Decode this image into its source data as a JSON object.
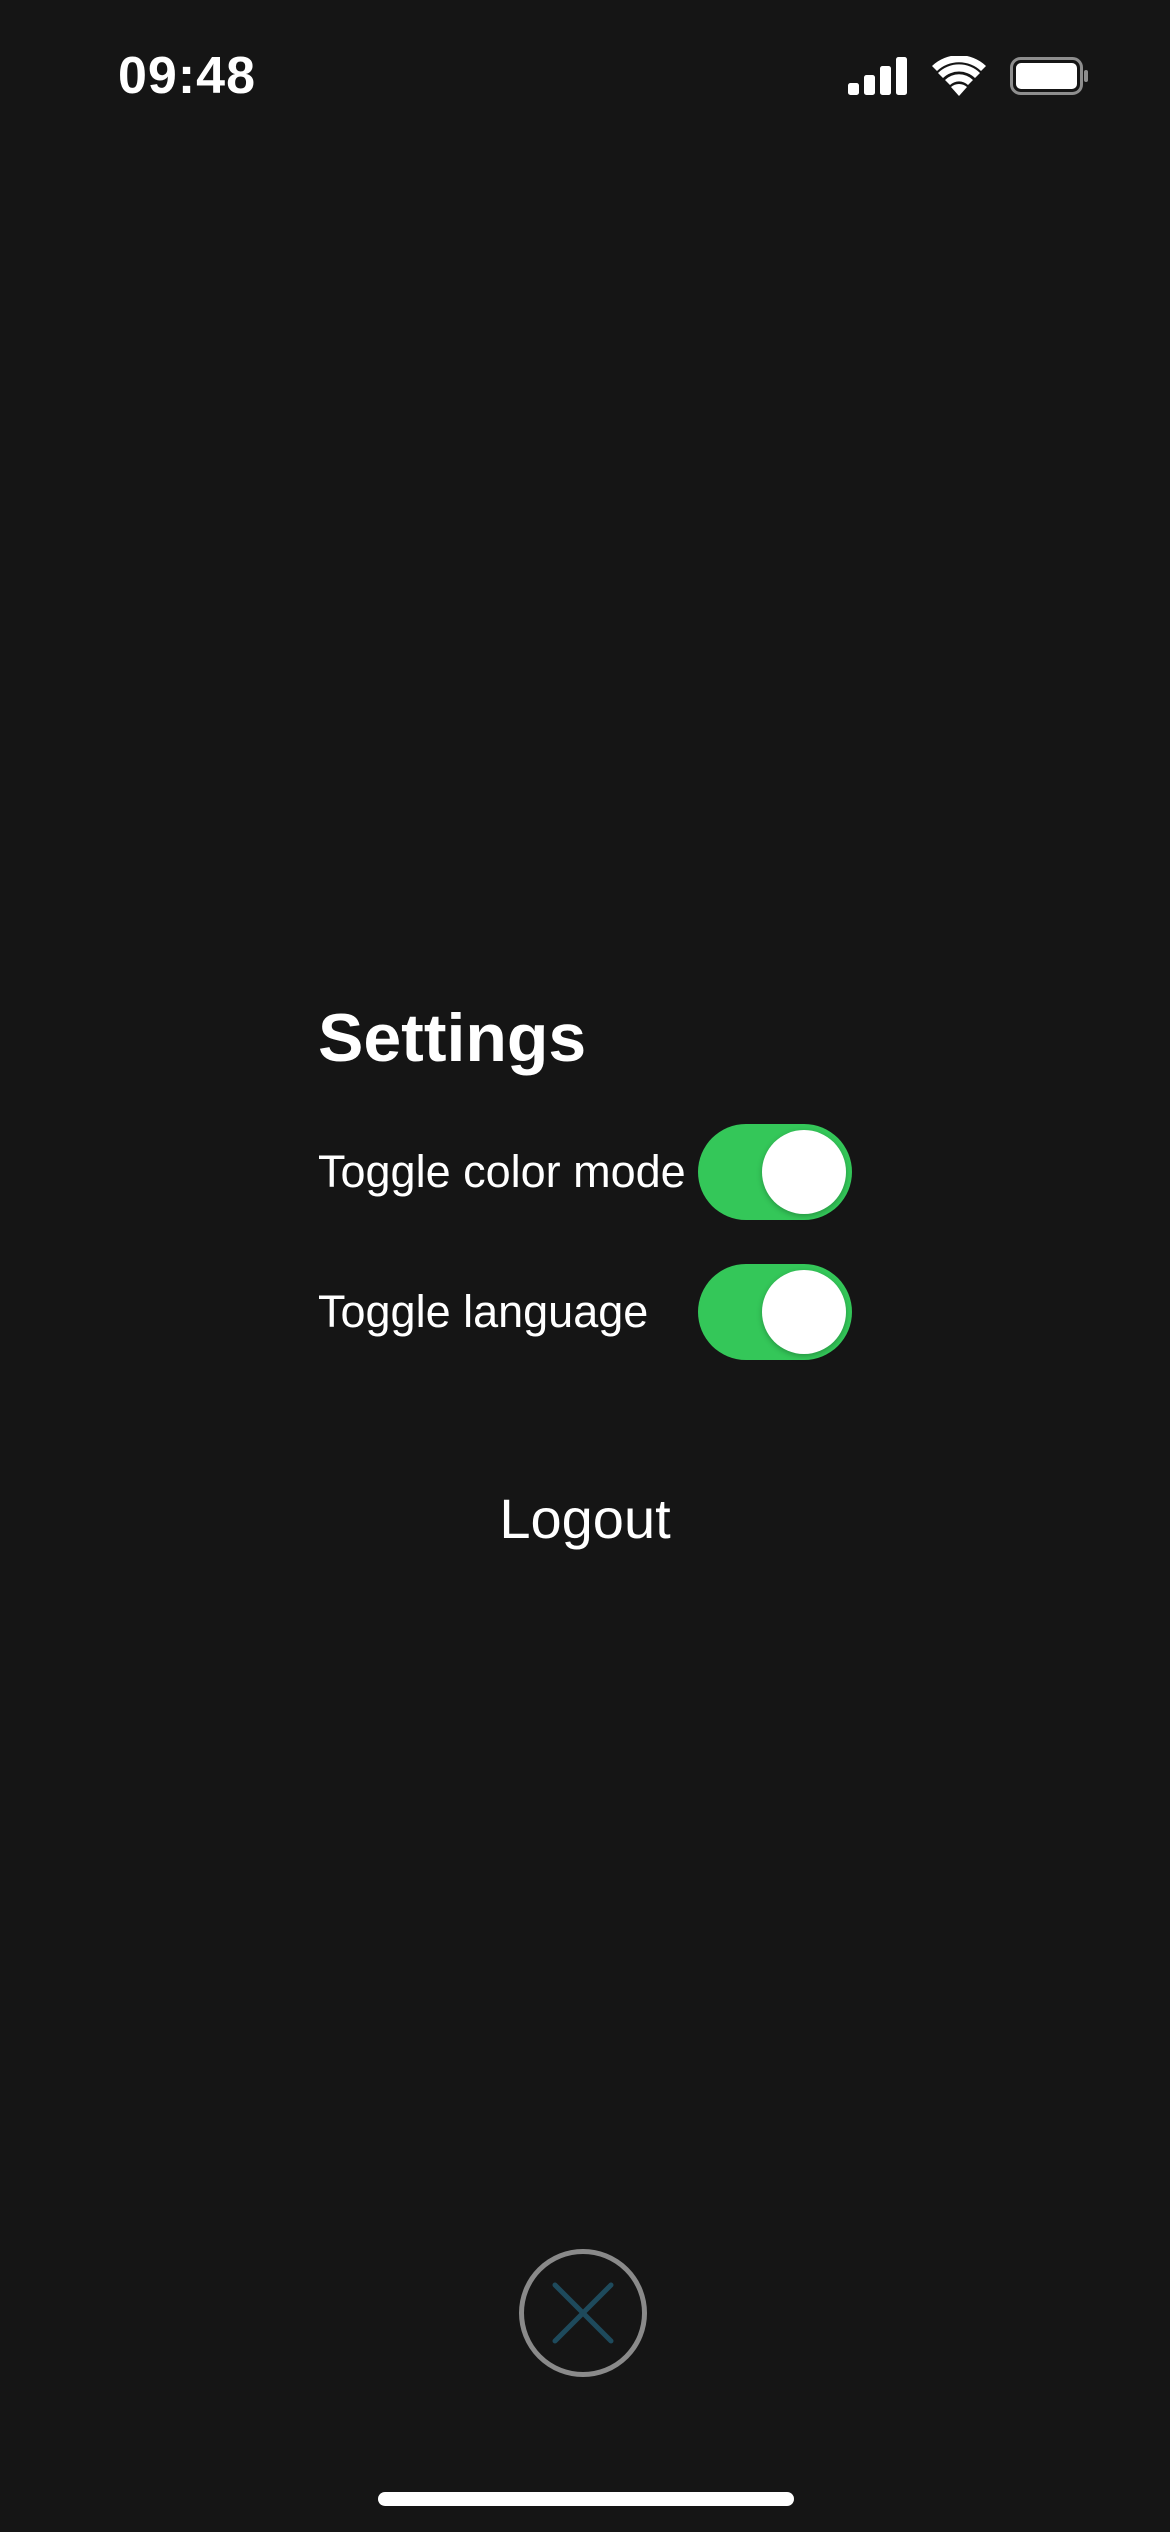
{
  "status_bar": {
    "time": "09:48",
    "icons": [
      "cellular-signal-icon",
      "wifi-icon",
      "battery-icon"
    ]
  },
  "settings": {
    "title": "Settings",
    "rows": [
      {
        "label": "Toggle color mode",
        "toggle_on": true
      },
      {
        "label": "Toggle language",
        "toggle_on": true
      }
    ],
    "logout_label": "Logout"
  },
  "close_button": {
    "icon": "close-icon"
  },
  "colors": {
    "background": "#151515",
    "toggle_on": "#34c759",
    "close_ring": "#8a8a8a",
    "close_x": "#1e4a5c",
    "text": "#ffffff"
  }
}
